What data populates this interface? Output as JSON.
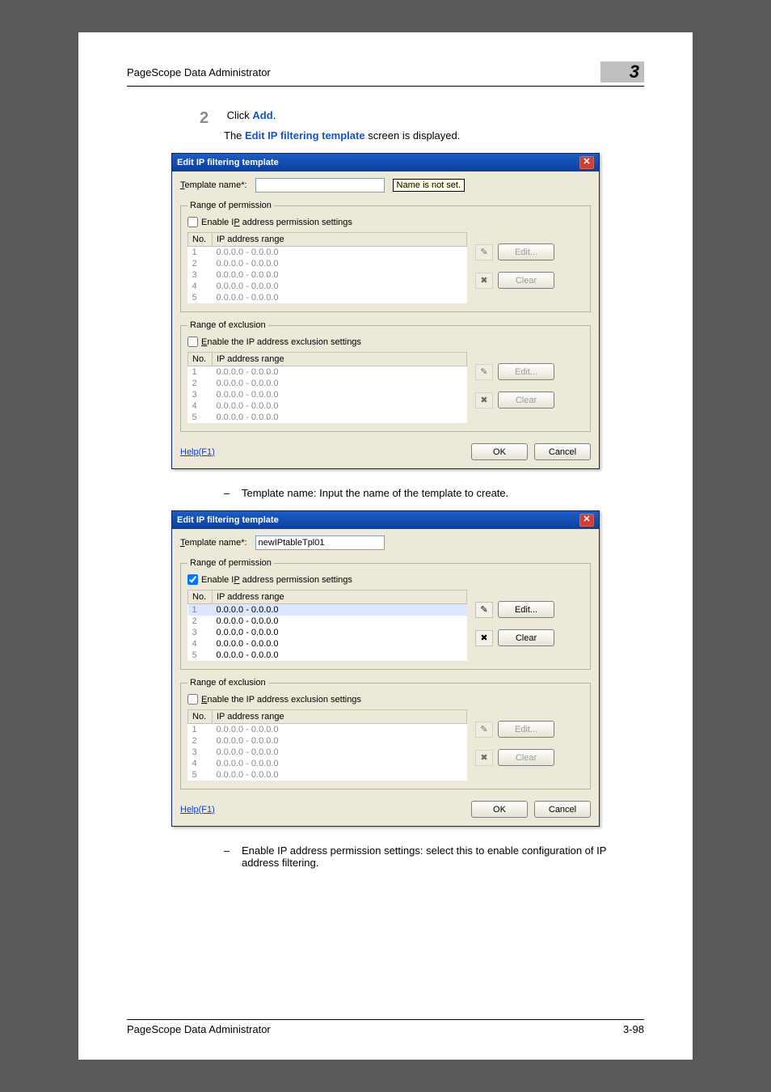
{
  "header": {
    "title": "PageScope Data Administrator",
    "chapter": "3"
  },
  "step": {
    "number": "2",
    "action": "Click ",
    "action_link": "Add",
    "action_tail": ".",
    "result_pre": "The ",
    "result_link": "Edit IP filtering template",
    "result_post": " screen is displayed."
  },
  "dialog1": {
    "title": "Edit IP filtering template",
    "tpl_label": "Template name*:",
    "tpl_value": "",
    "tooltip": "Name is not set.",
    "perm": {
      "legend": "Range of permission",
      "enable_label": "Enable IP address permission settings",
      "enable_checked": false,
      "cols": [
        "No.",
        "IP address range"
      ],
      "rows": [
        {
          "no": "1",
          "range": "0.0.0.0 - 0.0.0.0"
        },
        {
          "no": "2",
          "range": "0.0.0.0 - 0.0.0.0"
        },
        {
          "no": "3",
          "range": "0.0.0.0 - 0.0.0.0"
        },
        {
          "no": "4",
          "range": "0.0.0.0 - 0.0.0.0"
        },
        {
          "no": "5",
          "range": "0.0.0.0 - 0.0.0.0"
        }
      ],
      "edit": "Edit...",
      "clear": "Clear"
    },
    "excl": {
      "legend": "Range of exclusion",
      "enable_label": "Enable the IP address exclusion settings",
      "enable_checked": false,
      "cols": [
        "No.",
        "IP address range"
      ],
      "rows": [
        {
          "no": "1",
          "range": "0.0.0.0 - 0.0.0.0"
        },
        {
          "no": "2",
          "range": "0.0.0.0 - 0.0.0.0"
        },
        {
          "no": "3",
          "range": "0.0.0.0 - 0.0.0.0"
        },
        {
          "no": "4",
          "range": "0.0.0.0 - 0.0.0.0"
        },
        {
          "no": "5",
          "range": "0.0.0.0 - 0.0.0.0"
        }
      ],
      "edit": "Edit...",
      "clear": "Clear"
    },
    "help": "Help(F1)",
    "ok": "OK",
    "cancel": "Cancel"
  },
  "bullet1": "Template name: Input the name of the template to create.",
  "dialog2": {
    "title": "Edit IP filtering template",
    "tpl_label": "Template name*:",
    "tpl_value": "newIPtableTpl01",
    "perm": {
      "legend": "Range of permission",
      "enable_label": "Enable IP address permission settings",
      "enable_checked": true,
      "cols": [
        "No.",
        "IP address range"
      ],
      "rows": [
        {
          "no": "1",
          "range": "0.0.0.0 - 0.0.0.0"
        },
        {
          "no": "2",
          "range": "0.0.0.0 - 0.0.0.0"
        },
        {
          "no": "3",
          "range": "0.0.0.0 - 0.0.0.0"
        },
        {
          "no": "4",
          "range": "0.0.0.0 - 0.0.0.0"
        },
        {
          "no": "5",
          "range": "0.0.0.0 - 0.0.0.0"
        }
      ],
      "edit": "Edit...",
      "clear": "Clear"
    },
    "excl": {
      "legend": "Range of exclusion",
      "enable_label": "Enable the IP address exclusion settings",
      "enable_checked": false,
      "cols": [
        "No.",
        "IP address range"
      ],
      "rows": [
        {
          "no": "1",
          "range": "0.0.0.0 - 0.0.0.0"
        },
        {
          "no": "2",
          "range": "0.0.0.0 - 0.0.0.0"
        },
        {
          "no": "3",
          "range": "0.0.0.0 - 0.0.0.0"
        },
        {
          "no": "4",
          "range": "0.0.0.0 - 0.0.0.0"
        },
        {
          "no": "5",
          "range": "0.0.0.0 - 0.0.0.0"
        }
      ],
      "edit": "Edit...",
      "clear": "Clear"
    },
    "help": "Help(F1)",
    "ok": "OK",
    "cancel": "Cancel"
  },
  "bullet2": "Enable IP address permission settings: select this to enable configuration of IP address filtering.",
  "footer": {
    "left": "PageScope Data Administrator",
    "right": "3-98"
  }
}
